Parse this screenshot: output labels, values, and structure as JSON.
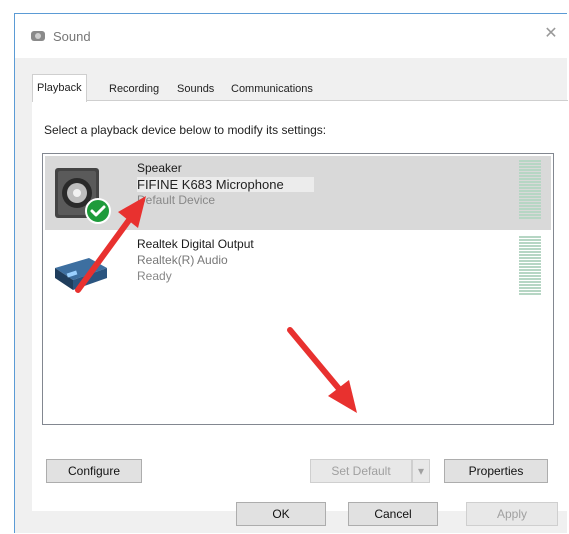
{
  "window": {
    "title": "Sound",
    "close_glyph": "✕"
  },
  "tabs": [
    {
      "label": "Playback",
      "active": true
    },
    {
      "label": "Recording",
      "active": false
    },
    {
      "label": "Sounds",
      "active": false
    },
    {
      "label": "Communications",
      "active": false
    }
  ],
  "instructions": "Select a playback device below to modify its settings:",
  "devices": [
    {
      "name": "Speaker",
      "description": "FIFINE K683 Microphone",
      "status": "Default Device",
      "icon": "speaker-icon",
      "selected": true,
      "default_badge": "check-icon"
    },
    {
      "name": "Realtek Digital Output",
      "description": "Realtek(R) Audio",
      "status": "Ready",
      "icon": "digital-output-icon",
      "selected": false
    }
  ],
  "buttons": {
    "configure": "Configure",
    "set_default": "Set Default",
    "set_default_dropdown": "▾",
    "properties": "Properties",
    "ok": "OK",
    "cancel": "Cancel",
    "apply": "Apply"
  },
  "annotations": [
    {
      "type": "arrow",
      "color": "#e8312f",
      "target": "default-device"
    },
    {
      "type": "arrow",
      "color": "#e8312f",
      "target": "set-default-button"
    }
  ]
}
